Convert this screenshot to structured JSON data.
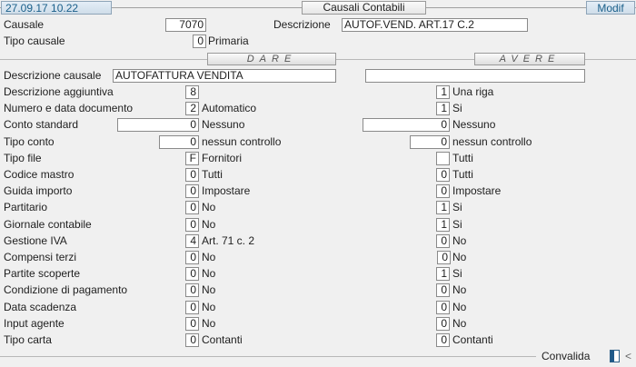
{
  "header": {
    "timestamp": "27.09.17 10.22",
    "title": "Causali Contabili",
    "mode": "Modif"
  },
  "top": {
    "causale_label": "Causale",
    "causale_value": "7070",
    "descrizione_label": "Descrizione",
    "descrizione_value": "AUTOF.VEND. ART.17 C.2",
    "tipo_causale_label": "Tipo causale",
    "tipo_causale_value": "0",
    "tipo_causale_text": "Primaria"
  },
  "sections": {
    "dare": "DARE",
    "avere": "AVERE"
  },
  "desc_causale": {
    "label": "Descrizione causale",
    "dare_value": "AUTOFATTURA VENDITA",
    "avere_value": ""
  },
  "rows": [
    {
      "label": "Descrizione aggiuntiva",
      "dare_value": "8",
      "dare_text": "",
      "avere_value": "1",
      "avere_text": "Una riga"
    },
    {
      "label": "Numero e data documento",
      "dare_value": "2",
      "dare_text": "Automatico",
      "avere_value": "1",
      "avere_text": "Si"
    },
    {
      "label": "Conto standard",
      "dare_value": "0",
      "dare_text": "Nessuno",
      "avere_value": "0",
      "avere_text": "Nessuno"
    },
    {
      "label": "Tipo conto",
      "dare_value": "0",
      "dare_text": "nessun controllo",
      "avere_value": "0",
      "avere_text": "nessun controllo"
    },
    {
      "label": "Tipo file",
      "dare_value": "F",
      "dare_text": "Fornitori",
      "avere_value": "",
      "avere_text": "Tutti"
    },
    {
      "label": "Codice mastro",
      "dare_value": "0",
      "dare_text": "Tutti",
      "avere_value": "0",
      "avere_text": "Tutti"
    },
    {
      "label": "Guida importo",
      "dare_value": "0",
      "dare_text": "Impostare",
      "avere_value": "0",
      "avere_text": "Impostare"
    },
    {
      "label": "Partitario",
      "dare_value": "0",
      "dare_text": "No",
      "avere_value": "1",
      "avere_text": "Si"
    },
    {
      "label": "Giornale contabile",
      "dare_value": "0",
      "dare_text": "No",
      "avere_value": "1",
      "avere_text": "Si"
    },
    {
      "label": "Gestione IVA",
      "dare_value": "4",
      "dare_text": "Art. 71 c. 2",
      "avere_value": "0",
      "avere_text": "No"
    },
    {
      "label": "Compensi terzi",
      "dare_value": "0",
      "dare_text": "No",
      "avere_value": "0",
      "avere_text": "No"
    },
    {
      "label": "Partite scoperte",
      "dare_value": "0",
      "dare_text": "No",
      "avere_value": "1",
      "avere_text": "Si"
    },
    {
      "label": "Condizione di pagamento",
      "dare_value": "0",
      "dare_text": "No",
      "avere_value": "0",
      "avere_text": "No"
    },
    {
      "label": "Data scadenza",
      "dare_value": "0",
      "dare_text": "No",
      "avere_value": "0",
      "avere_text": "No"
    },
    {
      "label": "Input agente",
      "dare_value": "0",
      "dare_text": "No",
      "avere_value": "0",
      "avere_text": "No"
    },
    {
      "label": "Tipo carta",
      "dare_value": "0",
      "dare_text": "Contanti",
      "avere_value": "0",
      "avere_text": "Contanti"
    }
  ],
  "footer": {
    "convalida_label": "Convalida",
    "arrow": "<"
  }
}
